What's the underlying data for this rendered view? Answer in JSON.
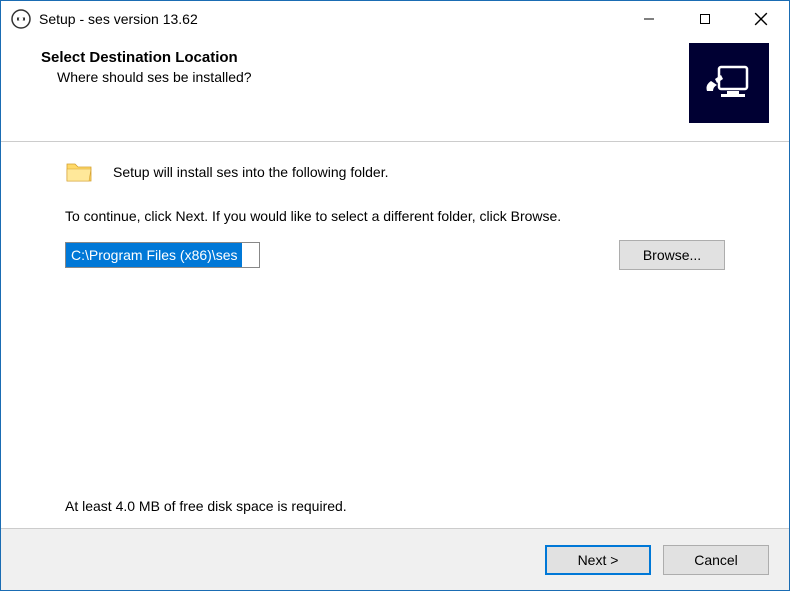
{
  "titlebar": {
    "title": "Setup - ses version 13.62"
  },
  "header": {
    "title": "Select Destination Location",
    "subtitle": "Where should ses be installed?"
  },
  "content": {
    "install_notice": "Setup will install ses into the following folder.",
    "instruction": "To continue, click Next. If you would like to select a different folder, click Browse.",
    "path_value": "C:\\Program Files (x86)\\ses",
    "browse_label": "Browse...",
    "disk_space": "At least 4.0 MB of free disk space is required."
  },
  "footer": {
    "next_label": "Next >",
    "cancel_label": "Cancel"
  }
}
